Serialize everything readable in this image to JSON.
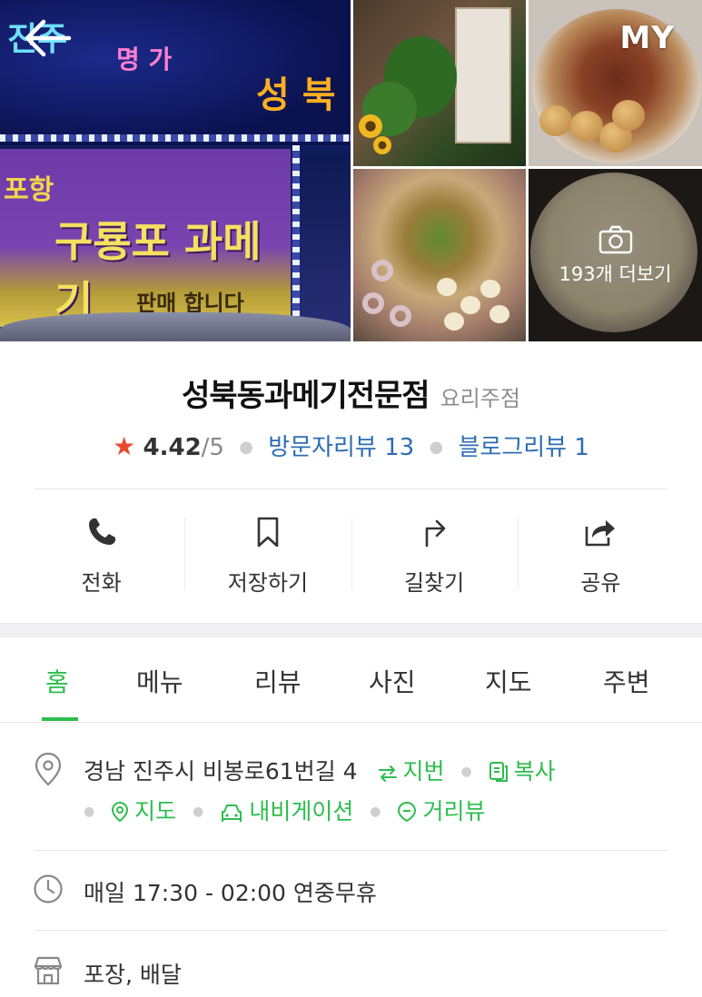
{
  "nav": {
    "my_label": "MY"
  },
  "photos": {
    "more_label": "193개 더보기"
  },
  "place": {
    "name": "성북동과메기전문점",
    "category": "요리주점",
    "rating_star": "★",
    "rating": "4.42",
    "rating_max": "/5",
    "visitor_reviews": "방문자리뷰 13",
    "blog_reviews": "블로그리뷰 1"
  },
  "actions": [
    {
      "label": "전화",
      "icon": "phone-icon"
    },
    {
      "label": "저장하기",
      "icon": "bookmark-icon"
    },
    {
      "label": "길찾기",
      "icon": "directions-icon"
    },
    {
      "label": "공유",
      "icon": "share-icon"
    }
  ],
  "tabs": [
    "홈",
    "메뉴",
    "리뷰",
    "사진",
    "지도",
    "주변"
  ],
  "active_tab": "홈",
  "info": {
    "address": "경남 진주시 비봉로61번길 4",
    "jibun": "지번",
    "copy": "복사",
    "map": "지도",
    "navigation": "내비게이션",
    "street_view": "거리뷰",
    "hours": "매일 17:30 - 02:00 연중무휴",
    "services": "포장, 배달"
  },
  "colors": {
    "accent": "#2dbd4e",
    "link": "#2e6db4",
    "star": "#e8482e"
  }
}
